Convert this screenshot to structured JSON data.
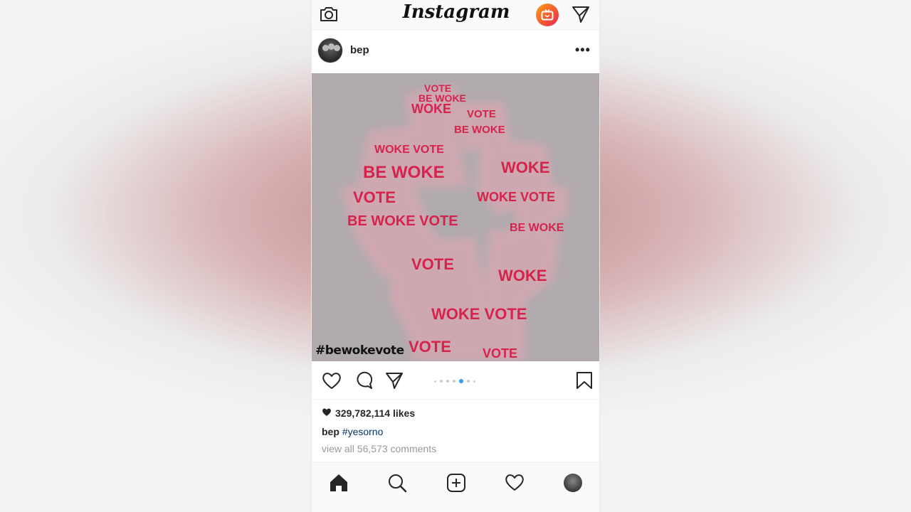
{
  "app": {
    "logo_text": "Instagram"
  },
  "top_bar": {
    "icons": [
      "camera-icon",
      "igtv-icon",
      "direct-message-icon"
    ],
    "igtv_gradient": [
      "#f8a21b",
      "#e8265d"
    ]
  },
  "post": {
    "username": "bep",
    "more_label": "•••",
    "image_overlay_hashtag": "#bewokevote",
    "image_words": [
      "VOTE",
      "BE WOKE",
      "WOKE",
      "VOTE",
      "BE WOKE",
      "WOKE VOTE",
      "BE WOKE",
      "VOTE",
      "WOKE",
      "BE WOKE VOTE",
      "WOKE VOTE",
      "BE WOKE",
      "VOTE",
      "WOKE"
    ],
    "word_color": "#d5234c",
    "carousel": {
      "count": 7,
      "active_index": 4,
      "accent": "#3897f0"
    },
    "likes_text": "329,782,114 likes",
    "caption_user": "bep",
    "caption_hashtag": "#yesorno",
    "comments_text": "view all 56,573 comments"
  },
  "tab_bar": {
    "items": [
      "home-icon",
      "search-icon",
      "add-post-icon",
      "activity-heart-icon",
      "profile-avatar"
    ]
  }
}
